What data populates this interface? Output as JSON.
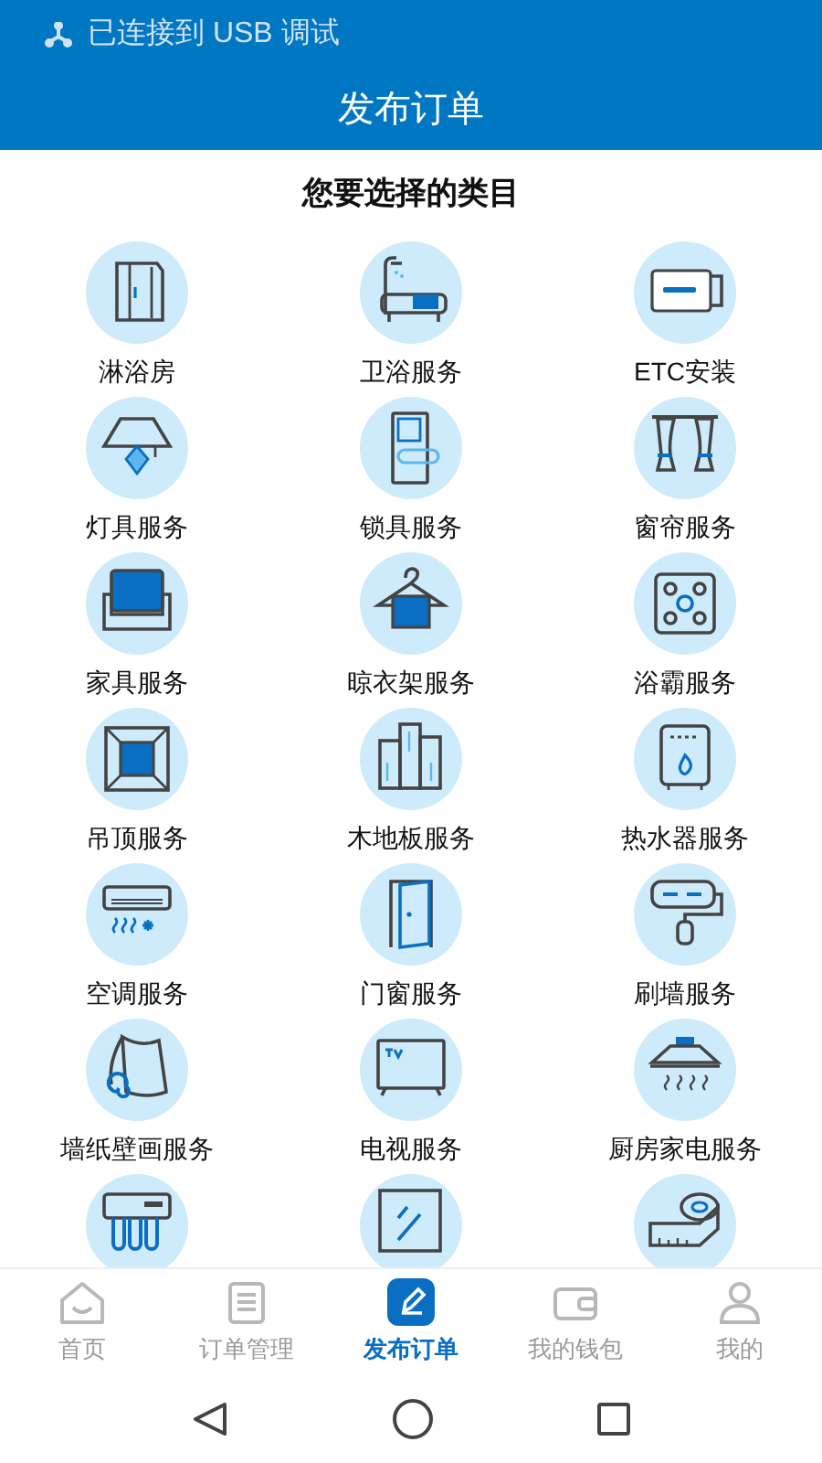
{
  "status_bar": {
    "text": "已连接到 USB 调试"
  },
  "title": "发布订单",
  "heading": "您要选择的类目",
  "categories": [
    {
      "kind": "labeled",
      "label": "淋浴房"
    },
    {
      "kind": "labeled",
      "label": "卫浴服务"
    },
    {
      "kind": "labeled",
      "label": "ETC安装"
    },
    {
      "kind": "labeled",
      "label": "灯具服务"
    },
    {
      "kind": "labeled",
      "label": "锁具服务"
    },
    {
      "kind": "labeled",
      "label": "窗帘服务"
    },
    {
      "kind": "labeled",
      "label": "家具服务"
    },
    {
      "kind": "labeled",
      "label": "晾衣架服务"
    },
    {
      "kind": "labeled",
      "label": "浴霸服务"
    },
    {
      "kind": "labeled",
      "label": "吊顶服务"
    },
    {
      "kind": "labeled",
      "label": "木地板服务"
    },
    {
      "kind": "labeled",
      "label": "热水器服务"
    },
    {
      "kind": "labeled",
      "label": "空调服务"
    },
    {
      "kind": "labeled",
      "label": "门窗服务"
    },
    {
      "kind": "labeled",
      "label": "刷墙服务"
    },
    {
      "kind": "labeled",
      "label": "墙纸壁画服务"
    },
    {
      "kind": "labeled",
      "label": "电视服务"
    },
    {
      "kind": "labeled",
      "label": "厨房家电服务"
    },
    {
      "kind": "cut_off"
    },
    {
      "kind": "cut_off"
    },
    {
      "kind": "cut_off"
    }
  ],
  "tabs": [
    {
      "label": "首页",
      "selected": false
    },
    {
      "label": "订单管理",
      "selected": false
    },
    {
      "label": "发布订单",
      "selected": true
    },
    {
      "label": "我的钱包",
      "selected": false
    },
    {
      "label": "我的",
      "selected": false
    }
  ]
}
